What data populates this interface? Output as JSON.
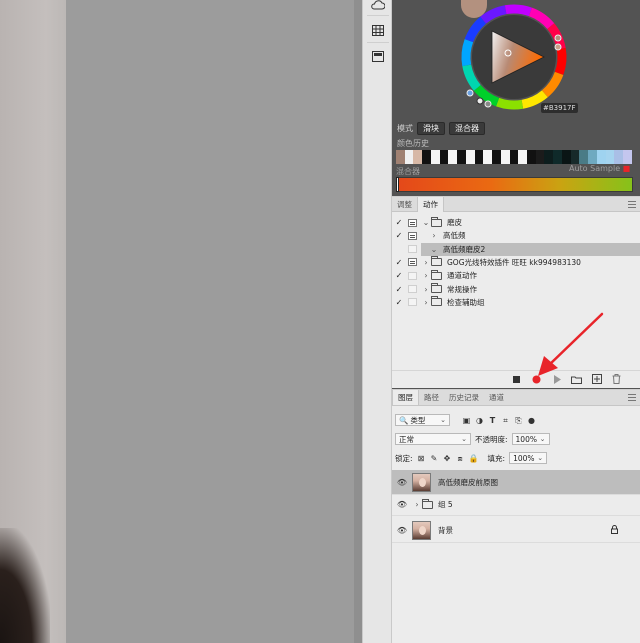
{
  "colors": {
    "foreground": "#B3917F",
    "accent_red": "#E8242A",
    "mixer_gradient": [
      "#E4481A",
      "#86C21A"
    ]
  },
  "color_panel": {
    "hex": "#B3917F",
    "mode_label": "模式",
    "mode_buttons": [
      "滑块",
      "混合器"
    ],
    "history_label": "颜色历史",
    "history_swatches": [
      "#a08172",
      "#f0f0f0",
      "#d7b8a6",
      "#111111",
      "#f4f4f4",
      "#111111",
      "#f4f4f4",
      "#111111",
      "#f4f4f4",
      "#111111",
      "#f4f4f4",
      "#111111",
      "#f4f4f4",
      "#111111",
      "#f4f4f4",
      "#111111",
      "#1b1b1b",
      "#0d1d1d",
      "#0f2a2a",
      "#0a1515",
      "#172a2a",
      "#4a7b86",
      "#6fa9c0",
      "#9fd3f0",
      "#a5d4ef",
      "#a9bfe6",
      "#c4c6ee"
    ],
    "mixer_label": "混合器",
    "auto_sample": "Auto Sample"
  },
  "tools": [
    "cloud-icon",
    "grid-icon",
    "swatch-icon"
  ],
  "actions_panel": {
    "tabs": [
      "调整",
      "动作"
    ],
    "rows": [
      {
        "check": "✓",
        "dialog": "on",
        "caret": "⌄",
        "folder": true,
        "label": "磨皮",
        "indent": 0,
        "selected": false
      },
      {
        "check": "✓",
        "dialog": "on",
        "caret": "›",
        "folder": false,
        "label": "高低频",
        "indent": 1,
        "selected": false
      },
      {
        "check": "",
        "dialog": "empty",
        "caret": "⌄",
        "folder": false,
        "label": "高低频磨皮2",
        "indent": 1,
        "selected": true
      },
      {
        "check": "✓",
        "dialog": "on",
        "caret": "›",
        "folder": true,
        "label": "GOG光线特效插件 旺旺 kk994983130",
        "indent": 0,
        "selected": false
      },
      {
        "check": "✓",
        "dialog": "empty",
        "caret": "›",
        "folder": true,
        "label": "通道动作",
        "indent": 0,
        "selected": false
      },
      {
        "check": "✓",
        "dialog": "empty",
        "caret": "›",
        "folder": true,
        "label": "常规操作",
        "indent": 0,
        "selected": false
      },
      {
        "check": "✓",
        "dialog": "empty",
        "caret": "›",
        "folder": true,
        "label": "检查辅助组",
        "indent": 0,
        "selected": false
      }
    ],
    "toolbar": [
      "stop-icon",
      "record-icon",
      "play-icon",
      "new-set-icon",
      "new-action-icon",
      "delete-icon"
    ]
  },
  "layers_panel": {
    "tabs": [
      "图层",
      "路径",
      "历史记录",
      "通道"
    ],
    "filter_value": "类型",
    "blend_mode": "正常",
    "opacity_label": "不透明度:",
    "opacity_value": "100%",
    "lock_label": "锁定:",
    "fill_label": "填充:",
    "fill_value": "100%",
    "layers": [
      {
        "name": "高低频磨皮前原图",
        "type": "image",
        "selected": true,
        "locked": false
      },
      {
        "name": "组 5",
        "type": "group",
        "selected": false,
        "locked": false
      },
      {
        "name": "背景",
        "type": "image",
        "selected": false,
        "locked": true
      }
    ]
  }
}
